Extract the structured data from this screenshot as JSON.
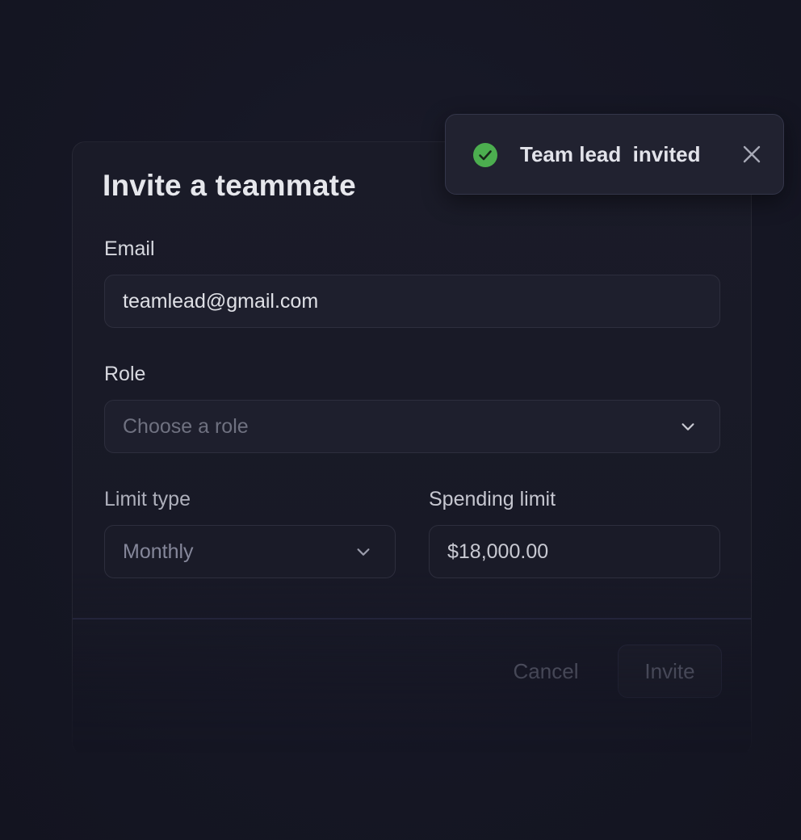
{
  "modal": {
    "title": "Invite a teammate",
    "email": {
      "label": "Email",
      "value": "teamlead@gmail.com"
    },
    "role": {
      "label": "Role",
      "placeholder": "Choose a role"
    },
    "limit_type": {
      "label": "Limit type",
      "selected": "Monthly"
    },
    "spending_limit": {
      "label": "Spending limit",
      "value": "$18,000.00"
    },
    "actions": {
      "cancel_label": "Cancel",
      "invite_label": "Invite"
    }
  },
  "toast": {
    "message": "Team lead  invited",
    "icon": "check-circle-icon",
    "close_icon": "close-icon"
  },
  "colors": {
    "background": "#141522",
    "success": "#4cae4f",
    "toast_bg": "#212230"
  }
}
